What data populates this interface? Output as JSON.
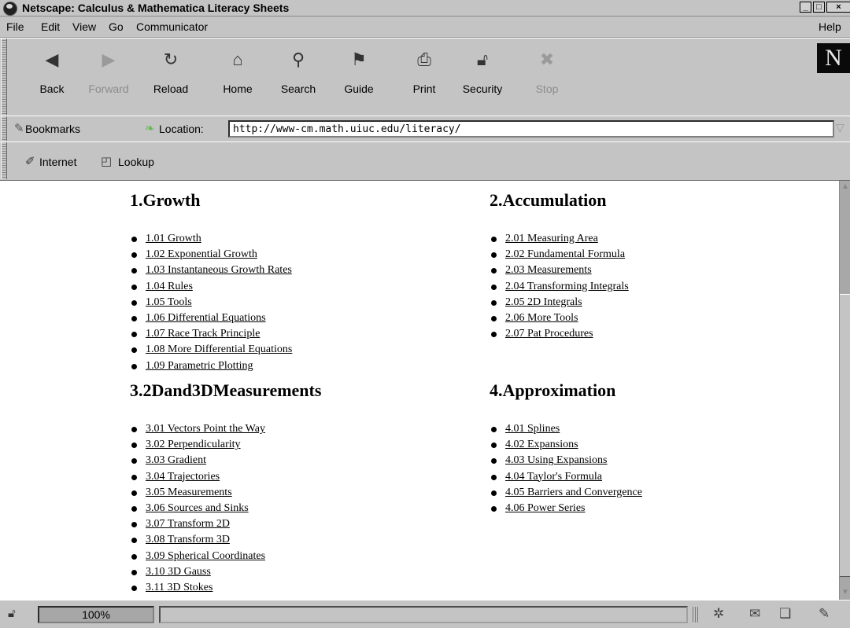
{
  "window": {
    "title": "Netscape: Calculus & Mathematica Literacy Sheets",
    "minimize_glyph": "_",
    "maximize_glyph": "□",
    "close_glyph": "×"
  },
  "menu": [
    "File",
    "Edit",
    "View",
    "Go",
    "Communicator",
    "Help"
  ],
  "nav_toolbar": {
    "buttons": [
      {
        "label": "Back",
        "icon": "back-arrow-icon",
        "enabled": true
      },
      {
        "label": "Forward",
        "icon": "forward-arrow-icon",
        "enabled": false
      },
      {
        "label": "Reload",
        "icon": "reload-icon",
        "enabled": true
      },
      {
        "label": "Home",
        "icon": "home-icon",
        "enabled": true
      },
      {
        "label": "Search",
        "icon": "search-icon",
        "enabled": true
      },
      {
        "label": "Guide",
        "icon": "guide-icon",
        "enabled": true
      },
      {
        "label": "Print",
        "icon": "print-icon",
        "enabled": true
      },
      {
        "label": "Security",
        "icon": "security-lock-icon",
        "enabled": true
      },
      {
        "label": "Stop",
        "icon": "stop-icon",
        "enabled": false
      }
    ],
    "logo_letter": "N"
  },
  "location_bar": {
    "bookmarks_label": "Bookmarks",
    "location_label": "Location:",
    "url": "http://www-cm.math.uiuc.edu/literacy/"
  },
  "personal_toolbar": {
    "items": [
      "Internet",
      "Lookup"
    ]
  },
  "content": {
    "sections": [
      {
        "heading": "1.Growth",
        "links": [
          "1.01 Growth",
          "1.02 Exponential Growth",
          "1.03 Instantaneous Growth Rates ",
          "1.04 Rules ",
          "1.05 Tools",
          "1.06 Differential Equations",
          "1.07 Race Track Principle",
          "1.08 More Differential Equations",
          "1.09 Parametric Plotting"
        ]
      },
      {
        "heading": "2.Accumulation",
        "links": [
          "2.01 Measuring Area",
          "2.02 Fundamental Formula",
          "2.03 Measurements",
          "2.04 Transforming Integrals",
          "2.05 2D Integrals",
          "2.06 More Tools",
          "2.07 Pat Procedures"
        ]
      },
      {
        "heading": "3.2Dand3DMeasurements",
        "links": [
          "3.01 Vectors Point the Way",
          "3.02 Perpendicularity",
          "3.03 Gradient",
          "3.04 Trajectories",
          "3.05 Measurements",
          "3.06 Sources and Sinks",
          "3.07 Transform 2D",
          "3.08 Transform 3D",
          "3.09 Spherical Coordinates",
          "3.10 3D Gauss",
          "3.11 3D Stokes"
        ]
      },
      {
        "heading": "4.Approximation",
        "links": [
          "4.01 Splines",
          "4.02 Expansions",
          "4.03 Using Expansions",
          "4.04 Taylor's Formula",
          "4.05 Barriers and Convergence",
          "4.06 Power Series"
        ]
      }
    ]
  },
  "status_bar": {
    "progress_text": "100%"
  }
}
